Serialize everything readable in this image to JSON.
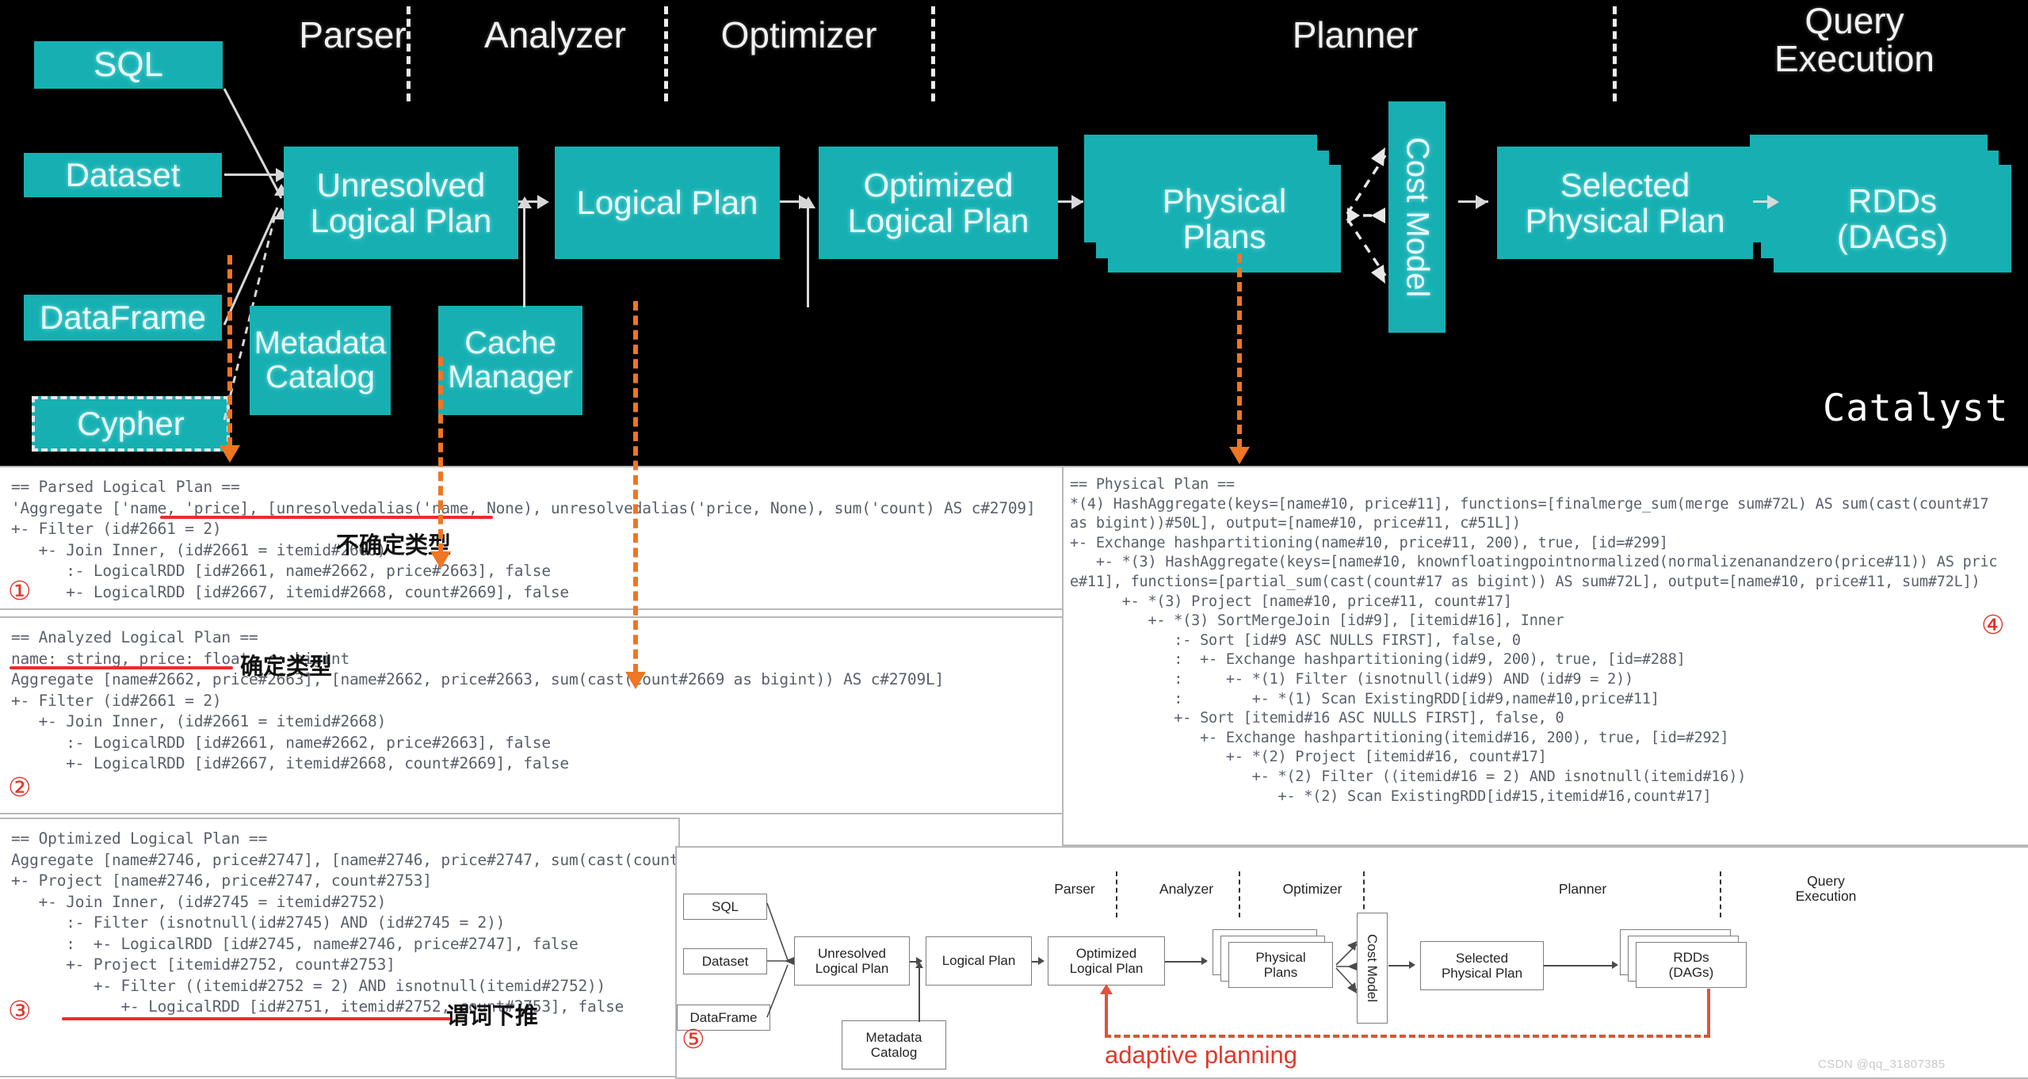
{
  "diagram": {
    "title": "Catalyst",
    "stages": [
      {
        "label": "Parser"
      },
      {
        "label": "Analyzer"
      },
      {
        "label": "Optimizer"
      },
      {
        "label": "Planner"
      },
      {
        "label": "Query\nExecution"
      }
    ],
    "inputs": [
      {
        "label": "SQL"
      },
      {
        "label": "Dataset"
      },
      {
        "label": "DataFrame"
      },
      {
        "label": "Cypher"
      }
    ],
    "nodes": [
      {
        "label": "Unresolved\nLogical Plan"
      },
      {
        "label": "Logical Plan"
      },
      {
        "label": "Optimized\nLogical Plan"
      },
      {
        "label": "Physical\nPlans"
      },
      {
        "label": "Cost Model"
      },
      {
        "label": "Selected\nPhysical Plan"
      },
      {
        "label": "RDDs\n(DAGs)"
      }
    ],
    "support": [
      {
        "label": "Metadata\nCatalog"
      },
      {
        "label": "Cache\nManager"
      }
    ],
    "accent_teal": "#16b0b3",
    "accent_orange": "#ef7622"
  },
  "panels": {
    "parsed": {
      "marker": "①",
      "annotation": "不确定类型",
      "code": "== Parsed Logical Plan ==\n'Aggregate ['name, 'price], [unresolvedalias('name, None), unresolvedalias('price, None), sum('count) AS c#2709]\n+- Filter (id#2661 = 2)\n   +- Join Inner, (id#2661 = itemid#2668)\n      :- LogicalRDD [id#2661, name#2662, price#2663], false\n      +- LogicalRDD [id#2667, itemid#2668, count#2669], false"
    },
    "analyzed": {
      "marker": "②",
      "annotation": "确定类型",
      "code": "== Analyzed Logical Plan ==\nname: string, price: float, c: bigint\nAggregate [name#2662, price#2663], [name#2662, price#2663, sum(cast(count#2669 as bigint)) AS c#2709L]\n+- Filter (id#2661 = 2)\n   +- Join Inner, (id#2661 = itemid#2668)\n      :- LogicalRDD [id#2661, name#2662, price#2663], false\n      +- LogicalRDD [id#2667, itemid#2668, count#2669], false"
    },
    "optimized": {
      "marker": "③",
      "annotation": "谓词下推",
      "code": "== Optimized Logical Plan ==\nAggregate [name#2746, price#2747], [name#2746, price#2747, sum(cast(count#2753 as bigint)) AS c#2763L]\n+- Project [name#2746, price#2747, count#2753]\n   +- Join Inner, (id#2745 = itemid#2752)\n      :- Filter (isnotnull(id#2745) AND (id#2745 = 2))\n      :  +- LogicalRDD [id#2745, name#2746, price#2747], false\n      +- Project [itemid#2752, count#2753]\n         +- Filter ((itemid#2752 = 2) AND isnotnull(itemid#2752))\n            +- LogicalRDD [id#2751, itemid#2752, count#2753], false"
    },
    "physical": {
      "marker": "④",
      "code": "== Physical Plan ==\n*(4) HashAggregate(keys=[name#10, price#11], functions=[finalmerge_sum(merge sum#72L) AS sum(cast(count#17\nas bigint))#50L], output=[name#10, price#11, c#51L])\n+- Exchange hashpartitioning(name#10, price#11, 200), true, [id=#299]\n   +- *(3) HashAggregate(keys=[name#10, knownfloatingpointnormalized(normalizenanandzero(price#11)) AS pric\ne#11], functions=[partial_sum(cast(count#17 as bigint)) AS sum#72L], output=[name#10, price#11, sum#72L])\n      +- *(3) Project [name#10, price#11, count#17]\n         +- *(3) SortMergeJoin [id#9], [itemid#16], Inner\n            :- Sort [id#9 ASC NULLS FIRST], false, 0\n            :  +- Exchange hashpartitioning(id#9, 200), true, [id=#288]\n            :     +- *(1) Filter (isnotnull(id#9) AND (id#9 = 2))\n            :        +- *(1) Scan ExistingRDD[id#9,name#10,price#11]\n            +- Sort [itemid#16 ASC NULLS FIRST], false, 0\n               +- Exchange hashpartitioning(itemid#16, 200), true, [id=#292]\n                  +- *(2) Project [itemid#16, count#17]\n                     +- *(2) Filter ((itemid#16 = 2) AND isnotnull(itemid#16))\n                        +- *(2) Scan ExistingRDD[id#15,itemid#16,count#17]"
    },
    "mini": {
      "marker": "⑤",
      "adaptive_label": "adaptive planning"
    }
  },
  "mini_diagram": {
    "stages": [
      {
        "label": "Parser"
      },
      {
        "label": "Analyzer"
      },
      {
        "label": "Optimizer"
      },
      {
        "label": "Planner"
      },
      {
        "label": "Query\nExecution"
      }
    ],
    "inputs": [
      {
        "label": "SQL"
      },
      {
        "label": "Dataset"
      },
      {
        "label": "DataFrame"
      }
    ],
    "nodes": [
      {
        "label": "Unresolved\nLogical Plan"
      },
      {
        "label": "Logical Plan"
      },
      {
        "label": "Optimized\nLogical Plan"
      },
      {
        "label": "Physical\nPlans"
      },
      {
        "label": "Cost Model"
      },
      {
        "label": "Selected\nPhysical Plan"
      },
      {
        "label": "RDDs\n(DAGs)"
      }
    ],
    "support": [
      {
        "label": "Metadata\nCatalog"
      }
    ]
  },
  "watermark": "CSDN @qq_31807385"
}
